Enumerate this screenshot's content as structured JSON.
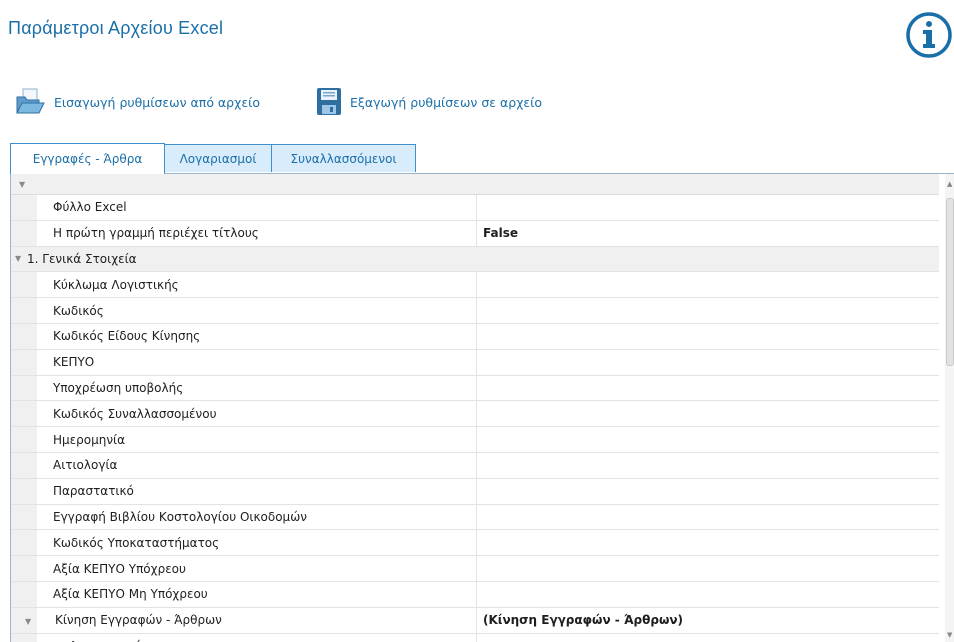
{
  "window": {
    "title": "Παράμετροι Αρχείου Excel",
    "info_icon": "info-circle-icon"
  },
  "toolbar": {
    "import_label": "Εισαγωγή ρυθμίσεων από αρχείο",
    "import_icon": "folder-open-icon",
    "export_label": "Εξαγωγή ρυθμίσεων σε αρχείο",
    "export_icon": "floppy-disk-icon"
  },
  "tabs": [
    {
      "label": "Εγγραφές - Άρθρα",
      "active": true
    },
    {
      "label": "Λογαριασμοί",
      "active": false
    },
    {
      "label": "Συναλλασσόμενοι",
      "active": false
    }
  ],
  "grid": {
    "rows": [
      {
        "kind": "prop",
        "label": "Φύλλο Excel",
        "value": ""
      },
      {
        "kind": "prop",
        "label": "Η πρώτη γραμμή περιέχει τίτλους",
        "value": "False"
      },
      {
        "kind": "category",
        "label": "1. Γενικά Στοιχεία"
      },
      {
        "kind": "prop",
        "label": "Κύκλωμα Λογιστικής",
        "value": ""
      },
      {
        "kind": "prop",
        "label": "Κωδικός",
        "value": ""
      },
      {
        "kind": "prop",
        "label": "Κωδικός Είδους Κίνησης",
        "value": ""
      },
      {
        "kind": "prop",
        "label": "ΚΕΠΥΟ",
        "value": ""
      },
      {
        "kind": "prop",
        "label": "Υποχρέωση υποβολής",
        "value": ""
      },
      {
        "kind": "prop",
        "label": "Κωδικός Συναλλασσομένου",
        "value": ""
      },
      {
        "kind": "prop",
        "label": "Ημερομηνία",
        "value": ""
      },
      {
        "kind": "prop",
        "label": "Αιτιολογία",
        "value": ""
      },
      {
        "kind": "prop",
        "label": "Παραστατικό",
        "value": ""
      },
      {
        "kind": "prop",
        "label": "Εγγραφή Βιβλίου Κοστολογίου Οικοδομών",
        "value": ""
      },
      {
        "kind": "prop",
        "label": "Κωδικός Υποκαταστήματος",
        "value": ""
      },
      {
        "kind": "prop",
        "label": "Αξία ΚΕΠΥΟ Υπόχρεου",
        "value": ""
      },
      {
        "kind": "prop",
        "label": "Αξία ΚΕΠΥΟ Μη Υπόχρεου",
        "value": ""
      },
      {
        "kind": "subgroup",
        "label": "Κίνηση Εγγραφών - Άρθρων",
        "value": "(Κίνηση Εγγραφών - Άρθρων)"
      },
      {
        "kind": "prop",
        "label": "Λογαριασμός",
        "value": ""
      }
    ]
  },
  "colors": {
    "accent": "#1b6fa8",
    "tab_inactive_bg": "#d9ecfb",
    "tab_border": "#3f8fcf",
    "gutter": "#f0f0f0"
  }
}
